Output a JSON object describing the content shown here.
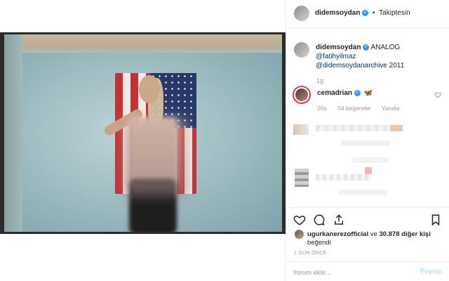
{
  "post": {
    "author": "didemsoydan",
    "follow_status": "Takiptesin",
    "caption_prefix": "ANALOG",
    "caption_mention_1": "@fatihyilmaz",
    "caption_mention_2": "@didemsoydanarchive",
    "caption_year": "2011",
    "caption_time": "1g"
  },
  "comment": {
    "author": "cemadrian",
    "emoji": "🦋",
    "time": "20s",
    "likes": "54 beğenme",
    "reply_label": "Yanıtla"
  },
  "likes": {
    "liker": "ugurkanerezofficial",
    "connector": "ve",
    "count_text": "30.878 diğer kişi",
    "suffix": "beğendi"
  },
  "time_ago": "1 GÜN ÖNCE",
  "composer": {
    "placeholder": "Yorum ekle...",
    "post_label": "Paylaş"
  },
  "colors": {
    "verified": "#3897f0",
    "link": "#003569",
    "post_button_disabled": "#b2dffc",
    "story_ring": "#e1306c"
  }
}
